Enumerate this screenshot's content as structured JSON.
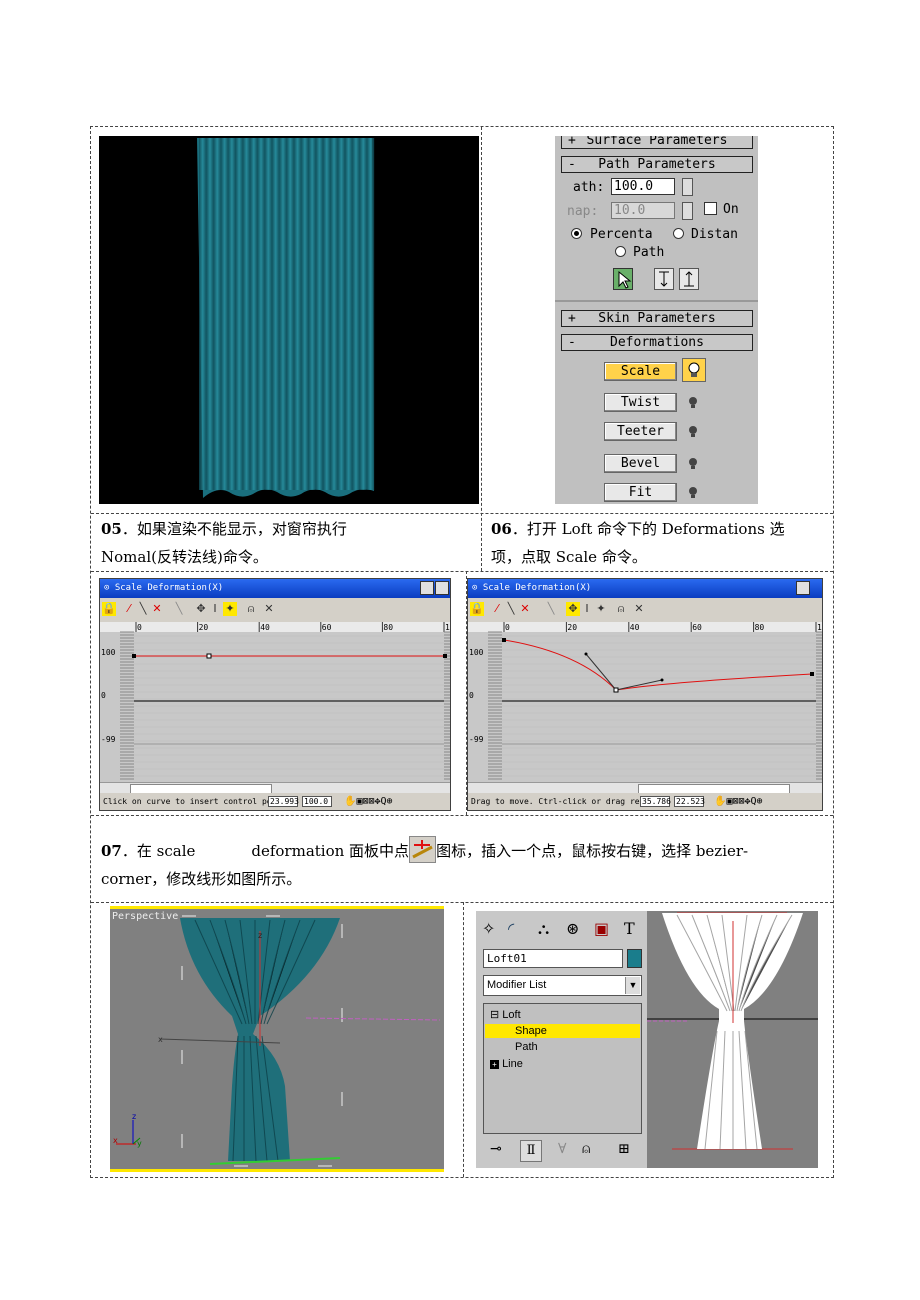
{
  "step05": {
    "num": "05",
    "text_line1": "如果渲染不能显示，对窗帘执行",
    "text_line2": "Nomal(反转法线)命令。"
  },
  "step06": {
    "num": "06",
    "text_line1": "打开 Loft 命令下的 Deformations 选",
    "text_line2": "项，点取 Scale 命令。"
  },
  "step07": {
    "num": "07",
    "text_a": "在 scale",
    "text_b": "deformation 面板中点",
    "text_c": "图标，插入一个点，鼠标按右键，选择 bezier-",
    "text_line2": "corner，修改线形如图所示。"
  },
  "panel06": {
    "surface_params": "Surface Parameters",
    "path_params": "Path Parameters",
    "path_label": "ath:",
    "path_value": "100.0",
    "snap_label": "nap:",
    "snap_value": "10.0",
    "on_label": "On",
    "percent_label": "Percenta",
    "distance_label": "Distan",
    "pathsteps_label": "Path",
    "skin_params": "Skin Parameters",
    "deformations": "Deformations",
    "buttons": [
      "Scale",
      "Twist",
      "Teeter",
      "Bevel",
      "Fit"
    ],
    "plus": "+",
    "minus": "-"
  },
  "scale_win_left": {
    "title": "Scale Deformation(X)",
    "ticks": [
      "0",
      "20",
      "40",
      "60",
      "80",
      "10"
    ],
    "ylabels": [
      "100",
      "0",
      "-99"
    ],
    "status_text": "Click on curve to insert control poin",
    "field1": "23.993",
    "field2": "100.0"
  },
  "scale_win_right": {
    "title": "Scale Deformation(X)",
    "ticks": [
      "0",
      "20",
      "40",
      "60",
      "80",
      "10"
    ],
    "ylabels": [
      "100",
      "0",
      "-99"
    ],
    "status_text": "Drag to move. Ctrl-click or drag regi",
    "field1": "35.786",
    "field2": "22.523"
  },
  "viewport": {
    "label": "Perspective",
    "axis_z": "z",
    "axis_x": "x",
    "axis_y": "y"
  },
  "modifier_panel": {
    "object_name": "Loft01",
    "modifier_list": "Modifier List",
    "stack": [
      "Loft",
      "Shape",
      "Path",
      "Line"
    ],
    "expand_minus": "⊟",
    "expand_plus": "⊞"
  },
  "colors": {
    "curtain": "#1f7d8c",
    "window_title": "#0a4ce0",
    "highlight": "#ffe800",
    "curve": "#e01010"
  }
}
